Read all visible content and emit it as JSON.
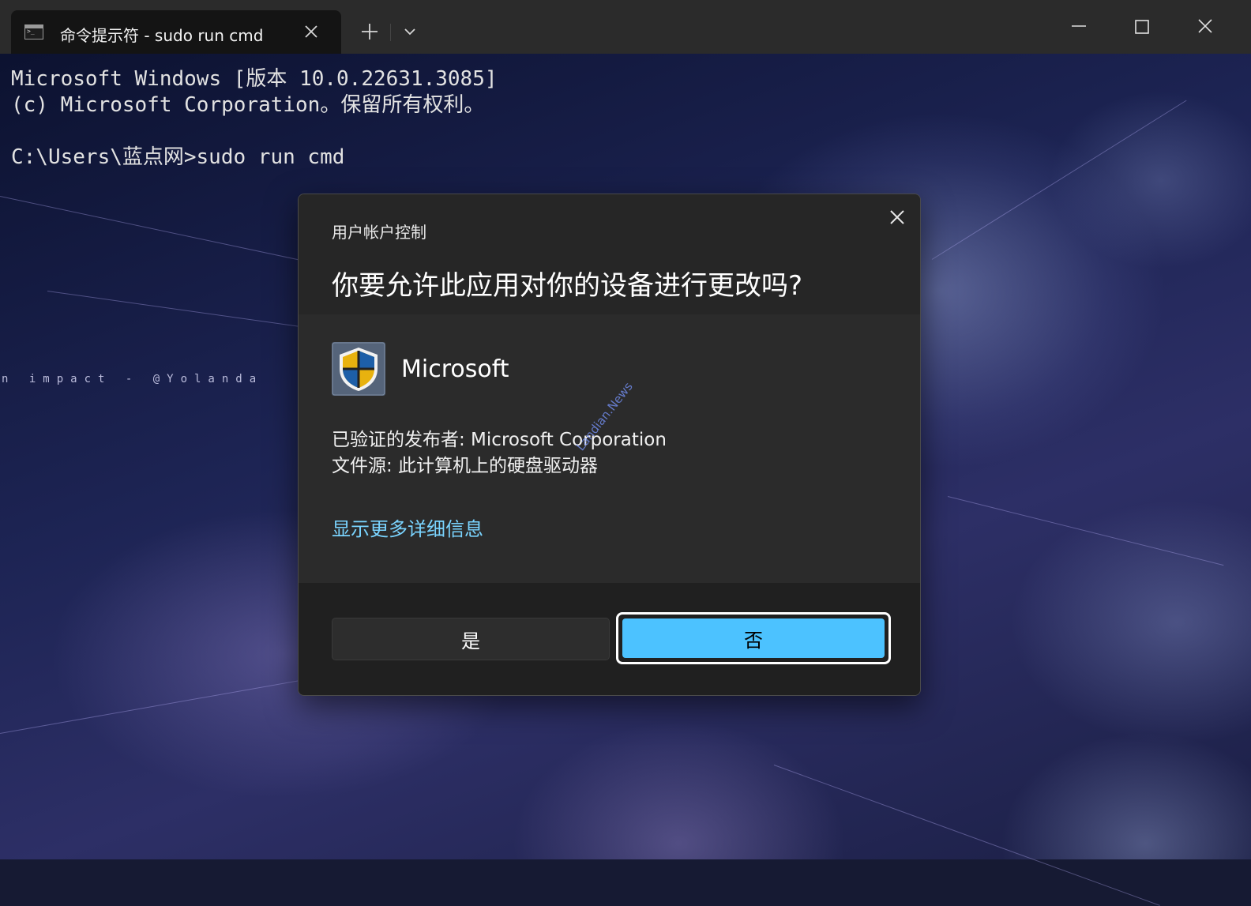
{
  "window": {
    "tab_title": "命令提示符 - sudo  run cmd",
    "new_tab_glyph": "+",
    "dropdown_glyph": "⌄"
  },
  "console": {
    "line1": "Microsoft Windows [版本 10.0.22631.3085]",
    "line2": "(c) Microsoft Corporation。保留所有权利。",
    "line3": "",
    "line4": "C:\\Users\\蓝点网>sudo run cmd"
  },
  "wallpaper": {
    "signature": "n  impact -  @Yolanda"
  },
  "dialog": {
    "label": "用户帐户控制",
    "question": "你要允许此应用对你的设备进行更改吗?",
    "app_name": "Microsoft",
    "publisher": "已验证的发布者: Microsoft Corporation",
    "source": "文件源: 此计算机上的硬盘驱动器",
    "watermark": "Landian.News",
    "more_details": "显示更多详细信息",
    "yes_label": "是",
    "no_label": "否",
    "accent_color": "#4cc2ff",
    "link_color": "#7ad4ff"
  }
}
